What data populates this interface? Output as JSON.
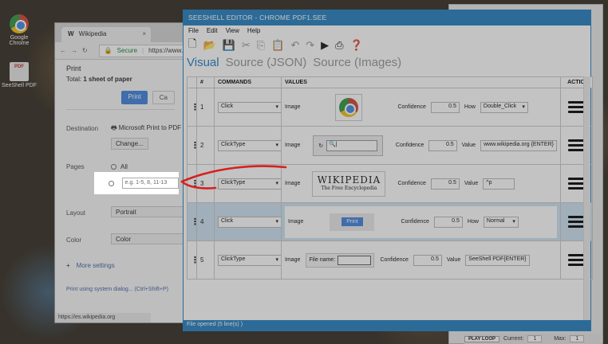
{
  "desktop": {
    "icons": [
      {
        "label": "Google Chrome",
        "icon": "chrome-icon"
      },
      {
        "label": "SeeShell PDF",
        "icon": "pdf-icon"
      }
    ]
  },
  "browser": {
    "tab_title": "Wikipedia",
    "secure_label": "Secure",
    "url": "https://www.w",
    "print": {
      "title": "Print",
      "total_prefix": "Total: ",
      "total_value": "1 sheet of paper",
      "print_button": "Print",
      "cancel_button": "Ca",
      "destination_label": "Destination",
      "destination_value": "Microsoft Print to PDF",
      "change_button": "Change...",
      "pages_label": "Pages",
      "pages_all": "All",
      "pages_placeholder": "e.g. 1-5, 8, 11-13",
      "layout_label": "Layout",
      "layout_value": "Portrait",
      "color_label": "Color",
      "color_value": "Color",
      "more_settings": "More settings",
      "system_dialog": "Print using system dialog... (Ctrl+Shift+P)"
    },
    "status_url": "https://es.wikipedia.org"
  },
  "editor": {
    "title": "SEESHELL EDITOR - CHROME PDF1.SEE",
    "menu": [
      "File",
      "Edit",
      "View",
      "Help"
    ],
    "tabs": {
      "visual": "Visual",
      "source_json": "Source (JSON)",
      "source_images": "Source (Images)"
    },
    "columns": [
      "#",
      "COMMANDS",
      "VALUES",
      "ACTION"
    ],
    "rows": [
      {
        "num": "1",
        "command": "Click",
        "image_label": "Image",
        "image_kind": "chrome-icon",
        "conf_label": "Confidence",
        "confidence": "0.5",
        "how_label": "How",
        "how": "Double_Click",
        "value_label": "",
        "value": ""
      },
      {
        "num": "2",
        "command": "ClickType",
        "image_label": "Image",
        "image_kind": "addressbar-snippet",
        "conf_label": "Confidence",
        "confidence": "0.5",
        "how_label": "",
        "how": "",
        "value_label": "Value",
        "value": "www.wikipedia.org {ENTER}"
      },
      {
        "num": "3",
        "command": "ClickType",
        "image_label": "Image",
        "image_kind": "wikipedia-logo",
        "conf_label": "Confidence",
        "confidence": "0.5",
        "how_label": "",
        "how": "",
        "value_label": "Value",
        "value": "^p"
      },
      {
        "num": "4",
        "command": "Click",
        "image_label": "Image",
        "image_kind": "print-button",
        "conf_label": "Confidence",
        "confidence": "0.5",
        "how_label": "How",
        "how": "Normal",
        "value_label": "",
        "value": ""
      },
      {
        "num": "5",
        "command": "ClickType",
        "image_label": "Image",
        "image_kind": "filename-field",
        "conf_label": "Confidence",
        "confidence": "0.5",
        "how_label": "",
        "how": "",
        "value_label": "Value",
        "value": "SeeShell PDF{ENTER}"
      }
    ],
    "image_snippets": {
      "wiki_title": "WIKIPEDIA",
      "wiki_sub": "The Free Encyclopedia",
      "print_btn": "Print",
      "file_name": "File name:"
    },
    "status": "File opened (5 line(s) )"
  },
  "backwin": {
    "play_loop": "PLAY LOOP",
    "current_label": "Current:",
    "current_value": "1",
    "max_label": "Max:",
    "max_value": "1"
  },
  "colors": {
    "accent": "#2f86c4",
    "selected_row": "#cfe3f2",
    "arrow": "#d62020"
  }
}
